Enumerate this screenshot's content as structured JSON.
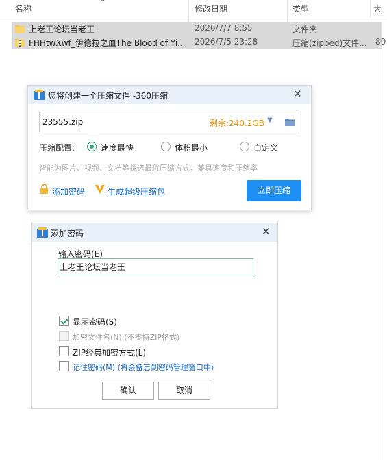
{
  "explorer": {
    "columns": {
      "name": "名称",
      "date": "修改日期",
      "type": "类型",
      "size": "大"
    },
    "rows": [
      {
        "name": "上老王论坛当老王",
        "date": "2026/7/7 8:55",
        "type": "文件夹",
        "size": ""
      },
      {
        "name": "FHHtwXwf_伊德拉之血The Blood of Yi...",
        "date": "2026/7/5 23:28",
        "type": "压缩(zipped)文件...",
        "size": "89"
      }
    ]
  },
  "compress_dialog": {
    "title": "您将创建一个压缩文件 -360压缩",
    "filename": "23555.zip",
    "free_space": "剩余:240.2GB",
    "config_label": "压缩配置:",
    "options": [
      "速度最快",
      "体积最小",
      "自定义"
    ],
    "selected_option": "速度最快",
    "hint": "智能为图片、视频、文档等挑选最优压缩方式，兼具速度和压缩率",
    "add_password": "添加密码",
    "super_pack": "生成超级压缩包",
    "compress_button": "立即压缩",
    "colors": {
      "accent": "#1e90f3",
      "free_space": "#e8940c",
      "link": "#1a6fd0"
    }
  },
  "password_dialog": {
    "title": "添加密码",
    "enter_label": "输入密码(E)",
    "password_value": "上老王论坛当老王",
    "options": [
      {
        "label": "显示密码(S)",
        "checked": true,
        "enabled": true
      },
      {
        "label": "加密文件名(N) (不支持ZIP格式)",
        "checked": false,
        "enabled": false
      },
      {
        "label": "ZIP经典加密方式(L)",
        "checked": false,
        "enabled": true
      },
      {
        "label": "记住密码(M) (将会备忘到密码管理窗口中)",
        "checked": false,
        "enabled": true
      }
    ],
    "ok": "确认",
    "cancel": "取消"
  }
}
